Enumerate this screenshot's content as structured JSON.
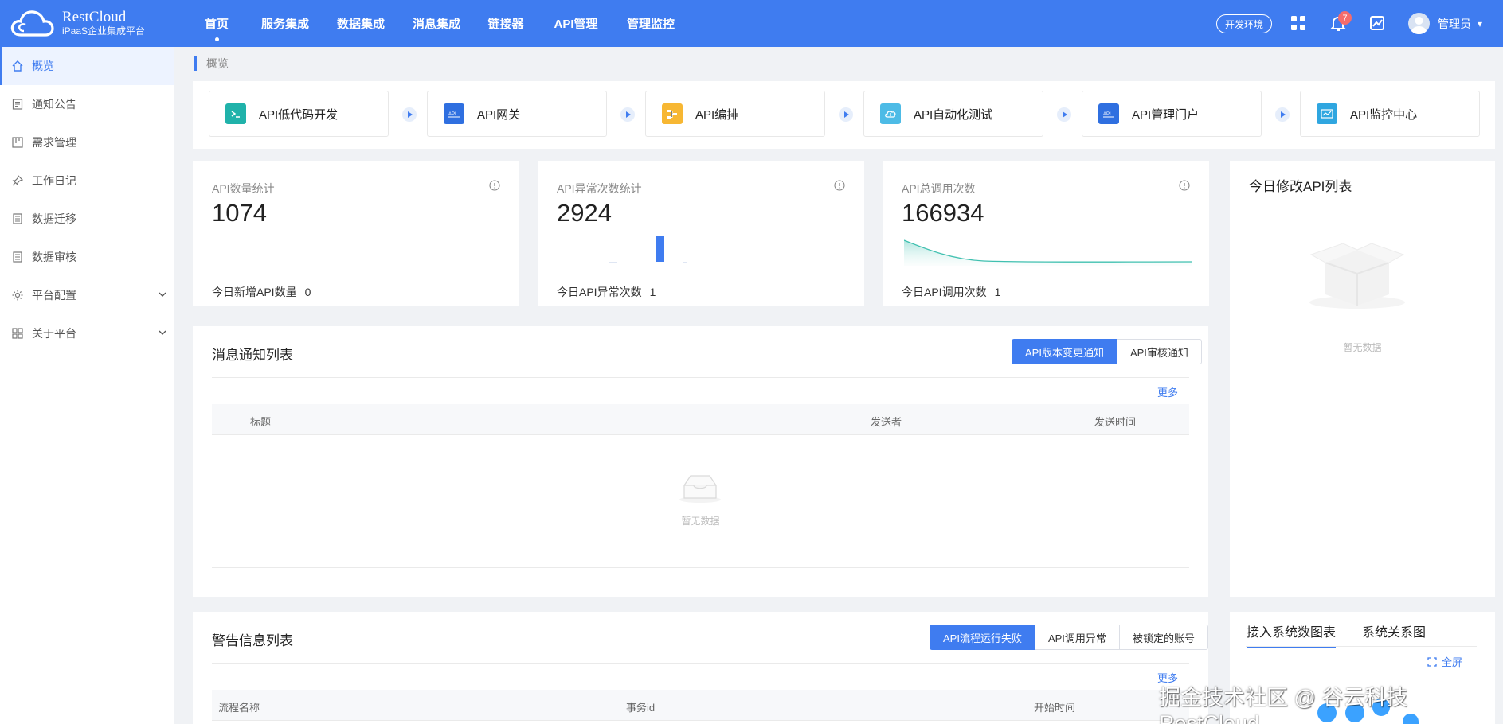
{
  "header": {
    "logo_title": "RestCloud",
    "logo_subtitle": "iPaaS企业集成平台",
    "nav": [
      {
        "label": "首页",
        "active": true
      },
      {
        "label": "服务集成"
      },
      {
        "label": "数据集成"
      },
      {
        "label": "消息集成"
      },
      {
        "label": "链接器"
      },
      {
        "label": "API管理"
      },
      {
        "label": "管理监控"
      }
    ],
    "env_label": "开发环境",
    "notification_count": "7",
    "user_name": "管理员",
    "user_caret": "▾"
  },
  "sidebar": {
    "items": [
      {
        "label": "概览",
        "icon": "home-icon",
        "active": true
      },
      {
        "label": "通知公告",
        "icon": "notice-icon"
      },
      {
        "label": "需求管理",
        "icon": "board-icon"
      },
      {
        "label": "工作日记",
        "icon": "pin-icon"
      },
      {
        "label": "数据迁移",
        "icon": "doc-icon"
      },
      {
        "label": "数据审核",
        "icon": "doc-icon"
      },
      {
        "label": "平台配置",
        "icon": "gear-icon",
        "expandable": true
      },
      {
        "label": "关于平台",
        "icon": "grid-icon",
        "expandable": true
      }
    ]
  },
  "breadcrumb": "概览",
  "flow": [
    {
      "label": "API低代码开发",
      "icon": "terminal-icon",
      "color": "#20b2aa"
    },
    {
      "label": "API网关",
      "icon": "api-icon",
      "color": "#2f6fe0"
    },
    {
      "label": "API编排",
      "icon": "orchestration-icon",
      "color": "#f7b733"
    },
    {
      "label": "API自动化测试",
      "icon": "cloud-test-icon",
      "color": "#4dbbe6"
    },
    {
      "label": "API管理门户",
      "icon": "api-portal-icon",
      "color": "#2f6fe0"
    },
    {
      "label": "API监控中心",
      "icon": "monitor-icon",
      "color": "#2fa6e0"
    }
  ],
  "stats": [
    {
      "title": "API数量统计",
      "value": "1074",
      "foot_label": "今日新增API数量",
      "foot_value": "0"
    },
    {
      "title": "API异常次数统计",
      "value": "2924",
      "foot_label": "今日API异常次数",
      "foot_value": "1"
    },
    {
      "title": "API总调用次数",
      "value": "166934",
      "foot_label": "今日API调用次数",
      "foot_value": "1"
    }
  ],
  "messages": {
    "title": "消息通知列表",
    "tabs": [
      "API版本变更通知",
      "API审核通知"
    ],
    "more": "更多",
    "columns": [
      "标题",
      "发送者",
      "发送时间"
    ],
    "empty": "暂无数据"
  },
  "alerts": {
    "title": "警告信息列表",
    "tabs": [
      "API流程运行失败",
      "API调用异常",
      "被锁定的账号"
    ],
    "more": "更多",
    "columns": [
      "流程名称",
      "事务id",
      "开始时间"
    ]
  },
  "today_api": {
    "title": "今日修改API列表",
    "empty": "暂无数据"
  },
  "system_charts": {
    "tabs": [
      "接入系统数图表",
      "系统关系图"
    ],
    "fullscreen": "全屏"
  },
  "watermark": "掘金技术社区 @ 谷云科技RestCloud",
  "colors": {
    "primary": "#3f7cf0",
    "badge": "#f56c6c"
  }
}
